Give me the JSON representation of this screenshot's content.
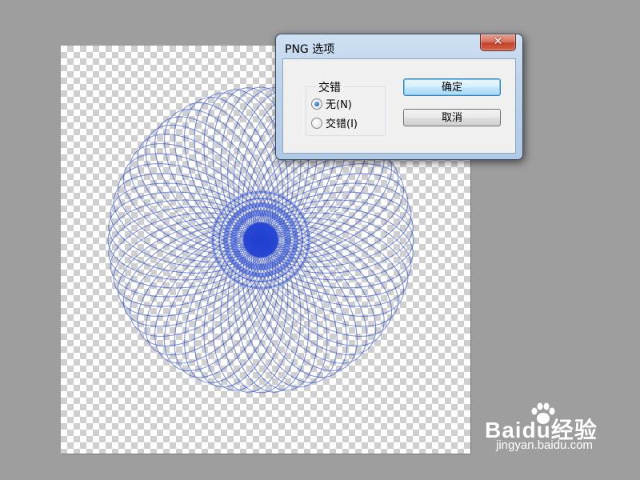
{
  "dialog": {
    "title": "PNG 选项",
    "close_label": "✕",
    "interlace": {
      "legend": "交错",
      "options": [
        {
          "label": "无(N)",
          "checked": true
        },
        {
          "label": "交错(I)",
          "checked": false
        }
      ]
    },
    "ok_label": "确定",
    "cancel_label": "取消"
  },
  "canvas": {
    "spirograph_color": "#2e4fd0",
    "center_color": "#1f3fd0",
    "checker_colors": [
      "#ffffff",
      "#cfcfcf"
    ]
  },
  "watermark": {
    "brand": "Baidu经验",
    "url": "jingyan.baidu.com",
    "icon": "paw-icon"
  },
  "colors": {
    "background": "#9e9e9e",
    "dialog_frame": "#bcd3ec",
    "close_button": "#c0412a"
  }
}
